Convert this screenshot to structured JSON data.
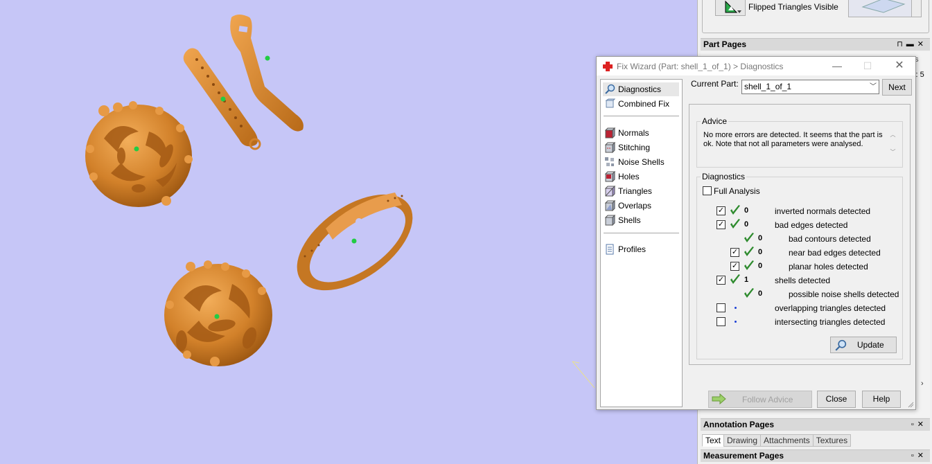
{
  "side_panel": {
    "flipped_triangles_label": "Flipped Triangles Visible",
    "part_pages_title": "Part Pages",
    "part_pages_partial_text": "s: 5",
    "part_pages_partial_tab": "es",
    "annotation_pages_title": "Annotation Pages",
    "annotation_tabs": [
      "Text",
      "Drawing",
      "Attachments",
      "Textures"
    ],
    "measurement_pages_title": "Measurement Pages"
  },
  "dialog": {
    "title": "Fix Wizard (Part: shell_1_of_1) > Diagnostics",
    "nav_top": [
      {
        "label": "Diagnostics",
        "icon": "magnifier-icon"
      },
      {
        "label": "Combined Fix",
        "icon": "combined-fix-icon"
      }
    ],
    "nav_mid": [
      {
        "label": "Normals",
        "icon": "normals-icon"
      },
      {
        "label": "Stitching",
        "icon": "stitching-icon"
      },
      {
        "label": "Noise Shells",
        "icon": "noise-shells-icon"
      },
      {
        "label": "Holes",
        "icon": "holes-icon"
      },
      {
        "label": "Triangles",
        "icon": "triangles-icon"
      },
      {
        "label": "Overlaps",
        "icon": "overlaps-icon"
      },
      {
        "label": "Shells",
        "icon": "shells-icon"
      }
    ],
    "nav_bottom": [
      {
        "label": "Profiles",
        "icon": "profiles-icon"
      }
    ],
    "current_part_label": "Current Part:",
    "current_part_value": "shell_1_of_1",
    "next_label": "Next",
    "advice_title": "Advice",
    "advice_text": "No more errors are detected. It seems that the part is ok. Note that not all parameters were analysed.",
    "diagnostics_title": "Diagnostics",
    "full_analysis_label": "Full Analysis",
    "full_analysis_checked": false,
    "rows": [
      {
        "checkbox": true,
        "checked": true,
        "status": "ok",
        "count": "0",
        "label": "inverted normals detected",
        "indent": 0
      },
      {
        "checkbox": true,
        "checked": true,
        "status": "ok",
        "count": "0",
        "label": "bad edges detected",
        "indent": 0
      },
      {
        "checkbox": false,
        "checked": false,
        "status": "ok",
        "count": "0",
        "label": "bad contours detected",
        "indent": 1
      },
      {
        "checkbox": true,
        "checked": true,
        "status": "ok",
        "count": "0",
        "label": "near bad edges detected",
        "indent": 1
      },
      {
        "checkbox": true,
        "checked": true,
        "status": "ok",
        "count": "0",
        "label": "planar holes detected",
        "indent": 1
      },
      {
        "checkbox": true,
        "checked": true,
        "status": "ok",
        "count": "1",
        "label": "shells detected",
        "indent": 0
      },
      {
        "checkbox": false,
        "checked": false,
        "status": "ok",
        "count": "0",
        "label": "possible noise shells detected",
        "indent": 1
      },
      {
        "checkbox": true,
        "checked": false,
        "status": "pending",
        "count": "",
        "label": "overlapping triangles detected",
        "indent": 0
      },
      {
        "checkbox": true,
        "checked": false,
        "status": "pending",
        "count": "",
        "label": "intersecting triangles detected",
        "indent": 0
      }
    ],
    "update_label": "Update",
    "follow_advice_label": "Follow Advice",
    "close_label": "Close",
    "help_label": "Help"
  },
  "colors": {
    "viewport_bg": "#c6c6f7",
    "model_orange": "#d98a2b",
    "check_green": "#2e8b2e",
    "pending_blue": "#1b3fd6"
  }
}
